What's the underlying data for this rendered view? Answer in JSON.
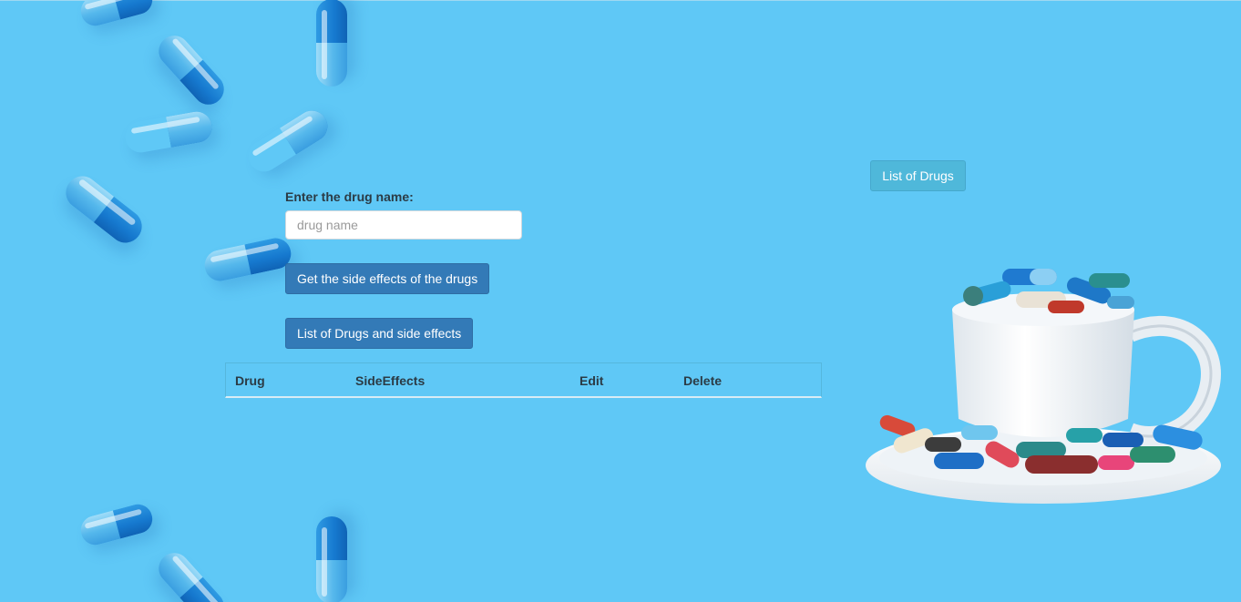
{
  "form": {
    "label": "Enter the drug name:",
    "input_value": "",
    "input_placeholder": "drug name",
    "side_effects_button": "Get the side effects of the drugs",
    "list_button": "List of Drugs and side effects"
  },
  "nav": {
    "list_of_drugs_button": "List of Drugs"
  },
  "table": {
    "columns": [
      "Drug",
      "SideEffects",
      "Edit",
      "Delete"
    ],
    "rows": []
  },
  "colors": {
    "background": "#5fc8f6",
    "primary_button": "#337ab7",
    "info_button": "#4fb8da"
  },
  "images": {
    "background_decor": "blue-capsules-pattern",
    "side_image": "cup-of-pills"
  }
}
